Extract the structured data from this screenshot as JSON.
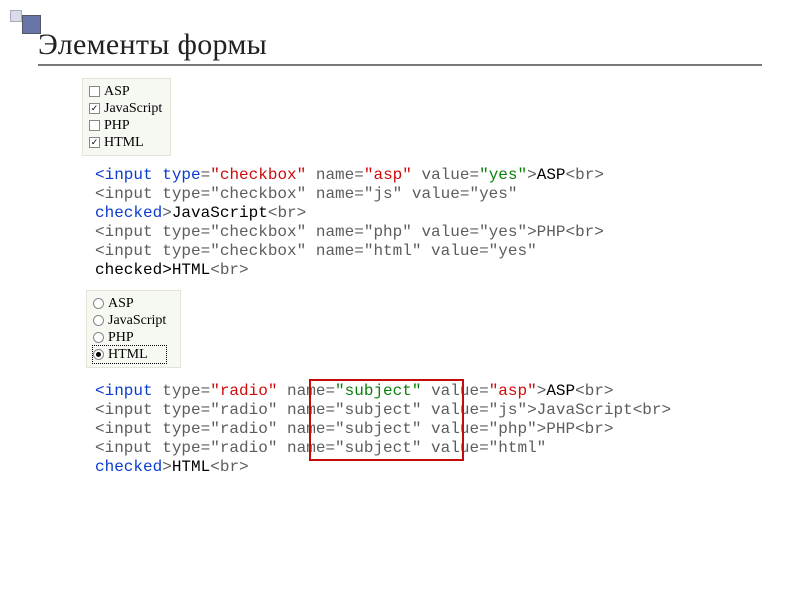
{
  "heading": "Элементы формы",
  "checkbox_form": {
    "items": [
      {
        "label": "ASP",
        "checked": false
      },
      {
        "label": "JavaScript",
        "checked": true
      },
      {
        "label": "PHP",
        "checked": false
      },
      {
        "label": "HTML",
        "checked": true
      }
    ]
  },
  "code_checkbox": {
    "l1_input": "<input",
    "l1_type": " type",
    "l1_eq": "=",
    "l1_typeval": "\"checkbox\"",
    "l1_name": " name=",
    "l1_nameval": "\"asp\"",
    "l1_value": " value=",
    "l1_valueval": "\"yes\"",
    "l1_gt": ">",
    "l1_text": "ASP",
    "l1_br": "<br>",
    "l2_prefix": "<input type=\"checkbox\" name=\"js\" value=\"yes\"",
    "l2_checked": "checked",
    "l2_gt": ">",
    "l2_text": "JavaScript",
    "l2_br": "<br>",
    "l3_full": "<input type=\"checkbox\" name=\"php\" value=\"yes\">PHP<br>",
    "l4_prefix": "<input type=\"checkbox\" name=\"html\" value=\"yes\"",
    "l4_checked": "checked>HTML",
    "l4_br": "<br>"
  },
  "radio_form": {
    "items": [
      {
        "label": "ASP",
        "checked": false
      },
      {
        "label": "JavaScript",
        "checked": false
      },
      {
        "label": "PHP",
        "checked": false
      },
      {
        "label": "HTML",
        "checked": true,
        "focus": true
      }
    ]
  },
  "code_radio": {
    "l1_input": "<input",
    "l1_type": " type=",
    "l1_typeval": "\"radio\"",
    "l1_name": " name=",
    "l1_nameval": "\"subject\"",
    "l1_value": " value=",
    "l1_valueval": "\"asp\"",
    "l1_gt": ">",
    "l1_text": "ASP",
    "l1_br": "<br>",
    "l2": "<input type=\"radio\" name=\"subject\" value=\"js\">JavaScript<br>",
    "l3": "<input type=\"radio\" name=\"subject\" value=\"php\">PHP<br>",
    "l4_prefix": "<input type=\"radio\" name=\"subject\" value=\"html\"",
    "l4_checked": "checked",
    "l4_gt": ">",
    "l4_text": "HTML",
    "l4_br": "<br>"
  }
}
